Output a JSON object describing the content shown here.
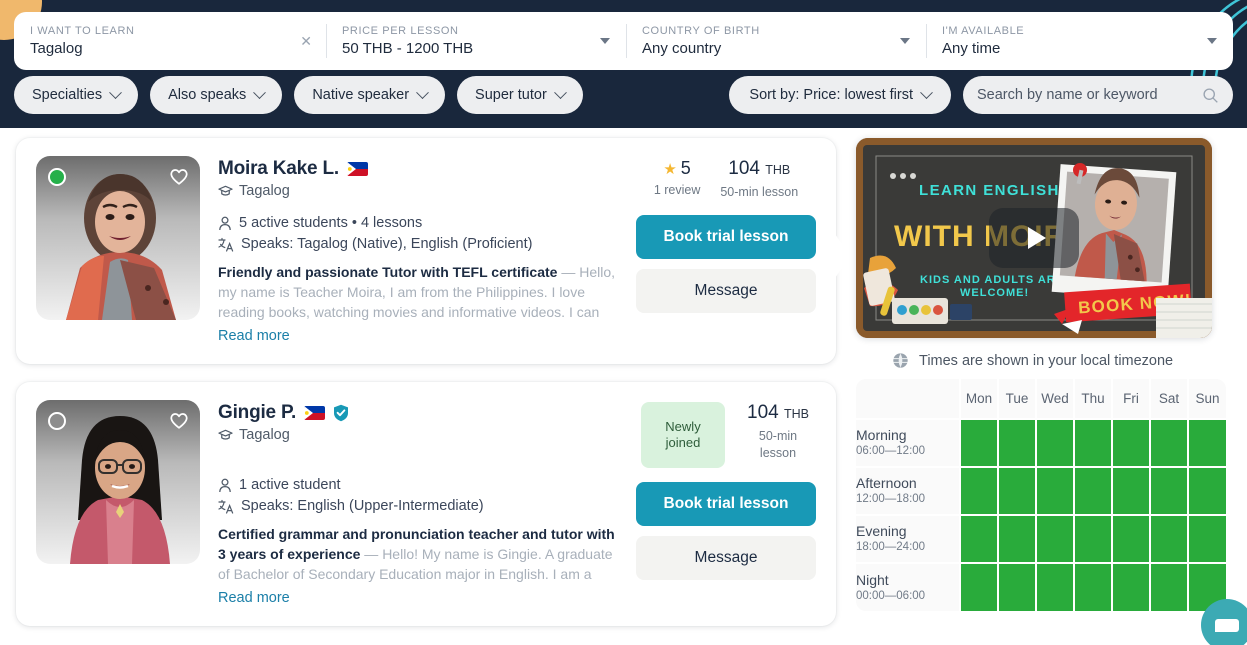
{
  "header": {
    "filters": [
      {
        "label": "I WANT TO LEARN",
        "value": "Tagalog",
        "control": "clear-x"
      },
      {
        "label": "PRICE PER LESSON",
        "value": "50 THB - 1200 THB",
        "control": "caret"
      },
      {
        "label": "COUNTRY OF BIRTH",
        "value": "Any country",
        "control": "caret"
      },
      {
        "label": "I'M AVAILABLE",
        "value": "Any time",
        "control": "caret"
      }
    ],
    "pills": [
      {
        "label": "Specialties"
      },
      {
        "label": "Also speaks"
      },
      {
        "label": "Native speaker"
      },
      {
        "label": "Super tutor"
      }
    ],
    "sort": {
      "label": "Sort by: Price: lowest first"
    },
    "search": {
      "placeholder": "Search by name or keyword",
      "icon": "search-icon"
    },
    "colors": {
      "bar_bg": "#19273c",
      "accent_teal": "#3fc5d8",
      "accent_orange": "#f0b86c"
    }
  },
  "tutors": [
    {
      "name": "Moira Kake L.",
      "country_flag": "philippines-flag",
      "verified": false,
      "status": "online",
      "subject": "Tagalog",
      "students_line": "5 active students • 4 lessons",
      "speaks_line": "Speaks: Tagalog (Native), English (Proficient)",
      "headline": "Friendly and passionate Tutor with TEFL certificate",
      "description": " — Hello, my name is Teacher Moira, I am from the Philippines. I love reading books, watching movies and informative videos. I can help you wit...",
      "read_more": "Read more",
      "rating": "5",
      "reviews": "1 review",
      "price": "104",
      "currency": "THB",
      "lesson_length": "50-min lesson",
      "badge": null,
      "book_label": "Book trial lesson",
      "message_label": "Message"
    },
    {
      "name": "Gingie P.",
      "country_flag": "philippines-flag",
      "verified": true,
      "status": "offline",
      "subject": "Tagalog",
      "students_line": "1 active student",
      "speaks_line": "Speaks: English (Upper-Intermediate)",
      "headline": "Certified grammar and pronunciation teacher and tutor with 3 years of experience",
      "description": " — Hello! My name is Gingie. A graduate of Bachelor of Secondary Education major in English. I am a professional teacher. A certified...",
      "read_more": "Read more",
      "rating": null,
      "reviews": null,
      "price": "104",
      "currency": "THB",
      "lesson_length": "50-min lesson",
      "badge": "Newly joined",
      "book_label": "Book trial lesson",
      "message_label": "Message"
    }
  ],
  "video": {
    "line1": "LEARN  ENGLISH",
    "line2": "WITH MOIRA!",
    "line3a": "KIDS AND ADULTS ARE",
    "line3b": "WELCOME!",
    "cta": "BOOK  NOW!",
    "play_icon": "play-icon"
  },
  "schedule": {
    "timezone_note": "Times are shown in your local timezone",
    "timezone_icon": "globe-icon",
    "days": [
      "Mon",
      "Tue",
      "Wed",
      "Thu",
      "Fri",
      "Sat",
      "Sun"
    ],
    "rows": [
      {
        "name": "Morning",
        "range": "06:00—12:00",
        "avail": [
          true,
          true,
          true,
          true,
          true,
          true,
          true
        ]
      },
      {
        "name": "Afternoon",
        "range": "12:00—18:00",
        "avail": [
          true,
          true,
          true,
          true,
          true,
          true,
          true
        ]
      },
      {
        "name": "Evening",
        "range": "18:00—24:00",
        "avail": [
          true,
          true,
          true,
          true,
          true,
          true,
          true
        ]
      },
      {
        "name": "Night",
        "range": "00:00—06:00",
        "avail": [
          true,
          true,
          true,
          true,
          true,
          true,
          true
        ]
      }
    ],
    "available_color": "#29ab3b"
  },
  "chat_widget": {
    "icon": "chat-bubble-icon"
  }
}
